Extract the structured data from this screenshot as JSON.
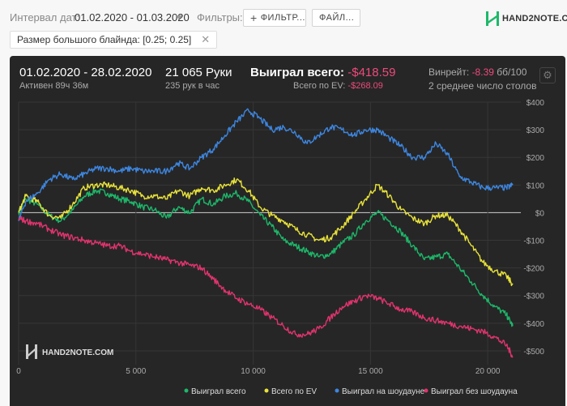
{
  "filters": {
    "date_label": "Интервал дат:",
    "date_value": "01.02.2020 - 01.03.2020",
    "filters_label": "Фильтры:",
    "filter_button": "ФИЛЬТР...",
    "file_button": "ФАЙЛ...",
    "chip_text": "Размер большого блайнда: [0.25; 0.25]"
  },
  "logo": {
    "text": "HAND2NOTE.COM",
    "watermark": "HAND2NOTE.COM"
  },
  "stats": {
    "range": "01.02.2020 - 28.02.2020",
    "active": "Активен 89ч 36м",
    "hands": "21 065 Руки",
    "hands_per_hour": "235 рук в час",
    "won_label": "Выиграл всего:",
    "won_value": "-$418.59",
    "ev_label": "Всего по EV:",
    "ev_value": "-$268.09",
    "winrate_label": "Винрейт:",
    "winrate_value": "-8.39",
    "winrate_unit": "бб/100",
    "tables": "2 среднее число столов"
  },
  "colors": {
    "green": "#1db86a",
    "yellow": "#e8e23a",
    "blue": "#3d86e0",
    "pink": "#e0336e",
    "zero_line": "#cfcfcf",
    "grid": "#363636"
  },
  "chart_data": {
    "type": "line",
    "xlim": [
      0,
      21065
    ],
    "ylim": [
      -550,
      400
    ],
    "xticks": [
      0,
      5000,
      10000,
      15000,
      20000
    ],
    "xtick_labels": [
      "0",
      "5 000",
      "10 000",
      "15 000",
      "20 000"
    ],
    "yticks": [
      400,
      300,
      200,
      100,
      0,
      -100,
      -200,
      -300,
      -400,
      -500
    ],
    "ytick_labels": [
      "$400",
      "$300",
      "$200",
      "$100",
      "$0",
      "-$100",
      "-$200",
      "-$300",
      "-$400",
      "-$500"
    ],
    "legend_placement": "bottom",
    "series": [
      {
        "name": "Выиграл всего",
        "color": "#1db86a",
        "x": [
          0,
          300,
          800,
          1300,
          1800,
          2300,
          2800,
          3300,
          3800,
          4300,
          4800,
          5300,
          5800,
          6300,
          6800,
          7300,
          7800,
          8300,
          8800,
          9300,
          9800,
          10300,
          10800,
          11300,
          11800,
          12300,
          12800,
          13300,
          13800,
          14300,
          14800,
          15300,
          15800,
          16300,
          16800,
          17300,
          17800,
          18300,
          18800,
          19300,
          19800,
          20300,
          20800,
          21065
        ],
        "y": [
          0,
          50,
          30,
          -10,
          -30,
          10,
          60,
          80,
          70,
          50,
          40,
          20,
          10,
          -20,
          20,
          0,
          50,
          30,
          60,
          70,
          40,
          -10,
          -50,
          -100,
          -120,
          -140,
          -160,
          -150,
          -110,
          -80,
          -30,
          0,
          -30,
          -70,
          -120,
          -170,
          -160,
          -150,
          -200,
          -250,
          -300,
          -340,
          -370,
          -410
        ]
      },
      {
        "name": "Всего по EV",
        "color": "#e8e23a",
        "x": [
          0,
          300,
          800,
          1300,
          1800,
          2300,
          2800,
          3300,
          3800,
          4300,
          4800,
          5300,
          5800,
          6300,
          6800,
          7300,
          7800,
          8300,
          8800,
          9300,
          9800,
          10300,
          10800,
          11300,
          11800,
          12300,
          12800,
          13300,
          13800,
          14300,
          14800,
          15300,
          15800,
          16300,
          16800,
          17300,
          17800,
          18300,
          18800,
          19300,
          19800,
          20300,
          20800,
          21065
        ],
        "y": [
          0,
          60,
          40,
          -10,
          -20,
          30,
          90,
          100,
          100,
          90,
          80,
          60,
          60,
          50,
          80,
          60,
          90,
          80,
          100,
          120,
          80,
          20,
          -10,
          -30,
          -60,
          -80,
          -100,
          -90,
          -50,
          0,
          50,
          100,
          60,
          10,
          -20,
          -40,
          -10,
          -10,
          -60,
          -120,
          -180,
          -210,
          -230,
          -260
        ]
      },
      {
        "name": "Выиграл на шоудауне",
        "color": "#3d86e0",
        "x": [
          0,
          300,
          800,
          1300,
          1800,
          2300,
          2800,
          3300,
          3800,
          4300,
          4800,
          5300,
          5800,
          6300,
          6800,
          7300,
          7800,
          8300,
          8800,
          9300,
          9800,
          10300,
          10800,
          11300,
          11800,
          12300,
          12800,
          13300,
          13800,
          14300,
          14800,
          15300,
          15800,
          16300,
          16800,
          17300,
          17800,
          18300,
          18800,
          19300,
          19800,
          20300,
          20800,
          21065
        ],
        "y": [
          -30,
          40,
          70,
          120,
          140,
          120,
          140,
          160,
          160,
          150,
          160,
          150,
          150,
          150,
          180,
          160,
          200,
          230,
          280,
          330,
          370,
          340,
          300,
          310,
          290,
          250,
          280,
          310,
          300,
          280,
          300,
          300,
          270,
          240,
          200,
          200,
          250,
          210,
          130,
          110,
          90,
          90,
          90,
          100
        ]
      },
      {
        "name": "Выиграл без шоудауна",
        "color": "#e0336e",
        "x": [
          0,
          300,
          800,
          1300,
          1800,
          2300,
          2800,
          3300,
          3800,
          4300,
          4800,
          5300,
          5800,
          6300,
          6800,
          7300,
          7800,
          8300,
          8800,
          9300,
          9800,
          10300,
          10800,
          11300,
          11800,
          12300,
          12800,
          13300,
          13800,
          14300,
          14800,
          15300,
          15800,
          16300,
          16800,
          17300,
          17800,
          18300,
          18800,
          19300,
          19800,
          20300,
          20800,
          21065
        ],
        "y": [
          -20,
          -30,
          -40,
          -60,
          -80,
          -90,
          -100,
          -110,
          -120,
          -120,
          -140,
          -150,
          -160,
          -170,
          -180,
          -190,
          -200,
          -240,
          -280,
          -310,
          -330,
          -350,
          -380,
          -410,
          -440,
          -440,
          -420,
          -380,
          -340,
          -320,
          -300,
          -310,
          -330,
          -350,
          -360,
          -380,
          -390,
          -400,
          -410,
          -420,
          -430,
          -450,
          -480,
          -520
        ]
      }
    ]
  }
}
